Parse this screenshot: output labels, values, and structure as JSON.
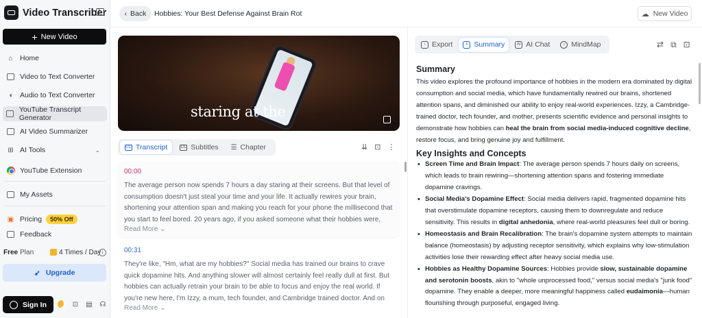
{
  "app": {
    "name": "Video Transcriber"
  },
  "sidebar": {
    "new_video": "New Video",
    "items": [
      {
        "label": "Home"
      },
      {
        "label": "Video to Text Converter"
      },
      {
        "label": "Audio to Text Converter"
      },
      {
        "label": "YouTube Transcript Generator"
      },
      {
        "label": "AI Video Summarizer"
      },
      {
        "label": "AI Tools"
      },
      {
        "label": "YouTube Extension"
      },
      {
        "label": "My Assets"
      },
      {
        "label": "Pricing"
      },
      {
        "label": "Feedback"
      }
    ],
    "promo": "50% Off",
    "plan": {
      "label": "Free",
      "suffix": "Plan",
      "times": "4 Times / Day"
    },
    "upgrade": "Upgrade",
    "sign_in": "Sign In"
  },
  "topbar": {
    "back": "Back",
    "title": "Hobbies: Your Best Defense Against Brain Rot",
    "new_video": "New Video"
  },
  "video": {
    "caption": "staring at the"
  },
  "transcript_tabs": [
    "Transcript",
    "Subtitles",
    "Chapter"
  ],
  "transcript": [
    {
      "time": "00:00",
      "text": "The average person now spends 7 hours a day staring at their screens. But that level of consumption doesn't just steal your time and your life. It actually rewires your brain, shortening your attention span and making you reach for your phone the millisecond that you start to feel bored. 20 years ago, if you asked someone what their hobbies were, they could probably tell ...",
      "read_more": "Read More"
    },
    {
      "time": "00:31",
      "text": "They're like, \"Hm, what are my hobbies?\" Social media has trained our brains to crave quick dopamine hits. And anything slower will almost certainly feel really dull at first. But hobbies can actually retrain your brain to be able to focus and enjoy the real world. If you're new here, I'm Izzy, a mum, tech founder, and Cambridge trained doctor. And on this channel, we explor...",
      "read_more": "Read More"
    }
  ],
  "right_tabs": [
    "Export",
    "Summary",
    "AI Chat",
    "MindMap"
  ],
  "summary": {
    "heading": "Summary",
    "para_1": "This video explores the profound importance of hobbies in the modern era dominated by digital consumption and social media, which have fundamentally rewired our brains, shortened attention spans, and diminished our ability to enjoy real-world experiences. Izzy, a Cambridge-trained doctor, tech founder, and mother, presents scientific evidence and personal insights to demonstrate how hobbies can ",
    "para_bold": "heal the brain from social media-induced cognitive decline",
    "para_2": ", restore focus, and bring genuine joy and fulfillment.",
    "insights_heading": "Key Insights and Concepts",
    "insights": [
      {
        "title": "Screen Time and Brain Impact",
        "text": ": The average person spends 7 hours daily on screens, which leads to brain rewiring—shortening attention spans and fostering immediate dopamine cravings."
      },
      {
        "title": "Social Media's Dopamine Effect",
        "text": ": Social media delivers rapid, fragmented dopamine hits that overstimulate dopamine receptors, causing them to downregulate and reduce sensitivity. This results in ",
        "bold": "digital anhedonia",
        "text_2": ", where real-world pleasures feel dull or boring."
      },
      {
        "title": "Homeostasis and Brain Recalibration",
        "text": ": The brain's dopamine system attempts to maintain balance (homeostasis) by adjusting receptor sensitivity, which explains why low-stimulation activities lose their rewarding effect after heavy social media use."
      },
      {
        "title": "Hobbies as Healthy Dopamine Sources",
        "text": ": Hobbies provide ",
        "bold": "slow, sustainable dopamine and serotonin boosts",
        "text_2": ", akin to \"whole unprocessed food,\" versus social media's \"junk food\" dopamine. They enable a deeper, more meaningful happiness called ",
        "bold_2": "eudaimonia",
        "text_3": "—human flourishing through purposeful, engaged living."
      }
    ]
  },
  "colors": {
    "accent": "#1b5fd6",
    "promo": "#ffd23f",
    "timestamp_1": "#d0306a",
    "timestamp_2": "#2d68d8"
  }
}
